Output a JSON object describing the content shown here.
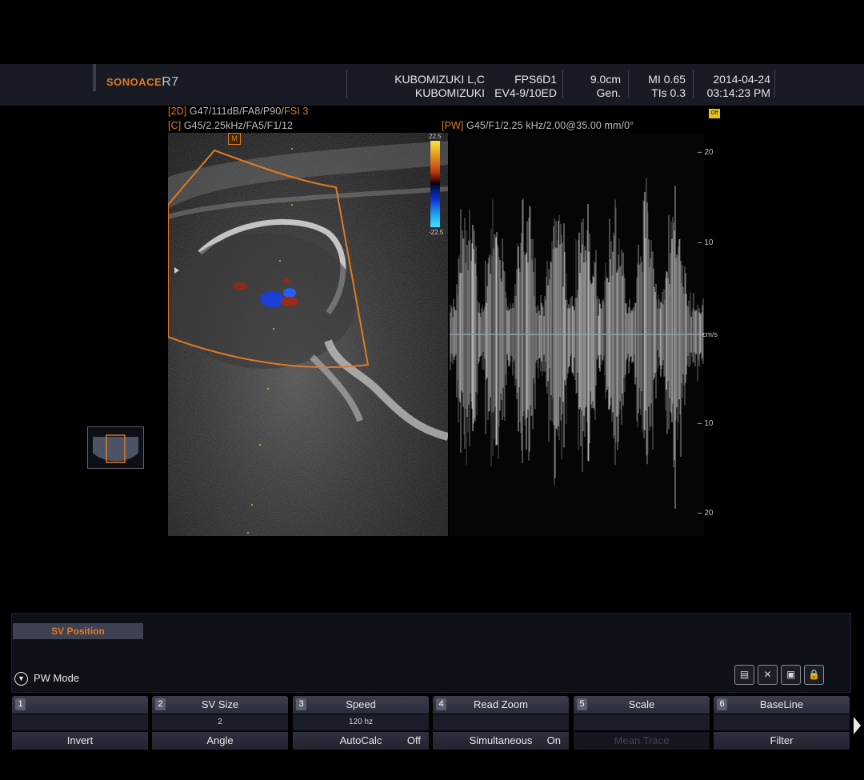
{
  "header": {
    "brand": "SONOACE",
    "model": "R7",
    "patient_name": "KUBOMIZUKI L,C",
    "patient_id": "KUBOMIZUKI",
    "preset": "FPS6D1",
    "probe": "EV4-9/10ED",
    "depth": "9.0cm",
    "application": "Gen.",
    "mi": "MI 0.65",
    "tis": "TIs 0.3",
    "date": "2014-04-24",
    "time": "03:14:23 PM",
    "freeze_badge": "Off"
  },
  "info_2d": {
    "tag": "[2D]",
    "params": " G47/111dB/FA8/P90/",
    "fsi": "FSI 3"
  },
  "info_color": {
    "tag": "[C]",
    "params": " G45/2.25kHz/FA5/F1/12"
  },
  "info_pw": {
    "tag": "[PW]",
    "params": " G45/F1/2.25 kHz/2.00@35.00 mm/0°"
  },
  "color_bar": {
    "top": "22.5",
    "bottom": "-22.5"
  },
  "doppler_scale": {
    "unit": "cm/s",
    "ticks": [
      "20",
      "10",
      "10",
      "20"
    ]
  },
  "sv_position_label": "SV Position",
  "pw_mode_label": "PW Mode",
  "toolbar_icons": [
    "report-icon",
    "measure-icon",
    "save-icon",
    "lock-icon"
  ],
  "softkeys": [
    {
      "num": "1",
      "label": "",
      "value": "",
      "bottom": "Invert",
      "bottom_state": ""
    },
    {
      "num": "2",
      "label": "SV Size",
      "value": "2",
      "bottom": "Angle",
      "bottom_state": ""
    },
    {
      "num": "3",
      "label": "Speed",
      "value": "120 hz",
      "bottom": "AutoCalc",
      "bottom_state": "Off"
    },
    {
      "num": "4",
      "label": "Read Zoom",
      "value": "",
      "bottom": "Simultaneous",
      "bottom_state": "On"
    },
    {
      "num": "5",
      "label": "Scale",
      "value": "",
      "bottom": "Mean Trace",
      "bottom_state": ""
    },
    {
      "num": "6",
      "label": "BaseLine",
      "value": "",
      "bottom": "Filter",
      "bottom_state": ""
    }
  ]
}
